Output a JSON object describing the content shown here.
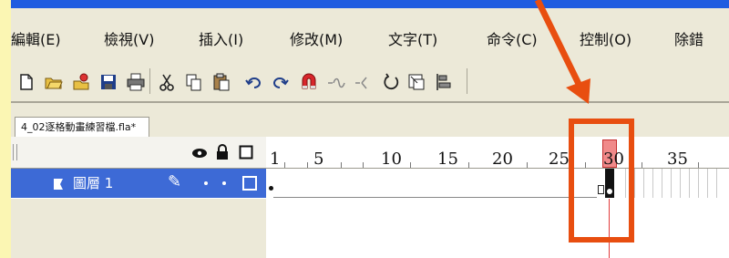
{
  "menubar": {
    "items": [
      "編輯(E)",
      "檢視(V)",
      "插入(I)",
      "修改(M)",
      "文字(T)",
      "命令(C)",
      "控制(O)",
      "除錯"
    ]
  },
  "toolbar": {
    "icons": [
      "new-icon",
      "open-icon",
      "open-from-site-icon",
      "save-icon",
      "print-icon",
      "cut-icon",
      "copy-icon",
      "paste-icon",
      "undo-icon",
      "redo-icon",
      "snap-to-objects-icon",
      "smooth-icon",
      "straighten-icon",
      "rotate-icon",
      "scale-icon",
      "align-icon"
    ]
  },
  "document_tab": {
    "label": "4_02逐格動畫練習檔.fla*"
  },
  "timeline": {
    "ruler_ticks": [
      "1",
      "5",
      "10",
      "15",
      "20",
      "25",
      "30",
      "35"
    ],
    "current_frame": "30",
    "layer": {
      "name": "圖層 1",
      "pencil_glyph": "✎"
    }
  },
  "colors": {
    "highlight_box": "#e84e10",
    "arrow": "#e84e10",
    "playhead": "#e23b3b",
    "layer_row": "#3d6ad6"
  }
}
